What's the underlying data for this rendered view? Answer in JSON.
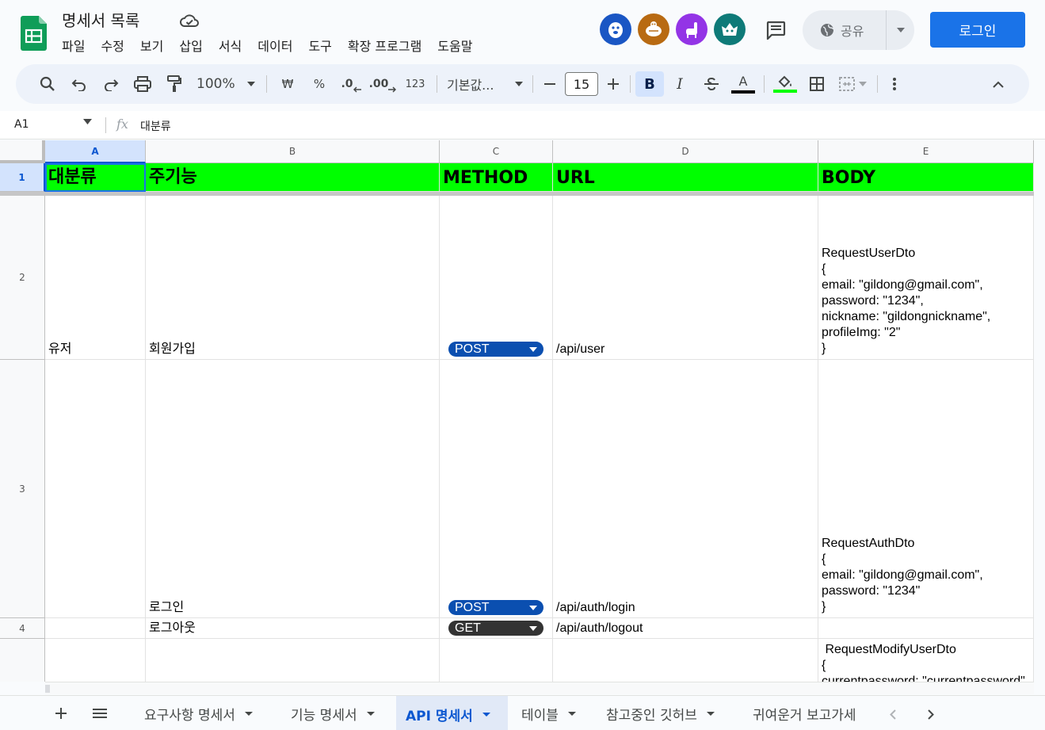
{
  "app": {
    "doc_title": "명세서 목록",
    "menus": [
      "파일",
      "수정",
      "보기",
      "삽입",
      "서식",
      "데이터",
      "도구",
      "확장 프로그램",
      "도움말"
    ],
    "share_label": "공유",
    "login_label": "로그인",
    "avatar_colors": [
      "#1a56c4",
      "#b86a12",
      "#9334e6",
      "#0e7a78"
    ]
  },
  "toolbar": {
    "zoom": "100%",
    "currency": "₩",
    "percent": "%",
    "decrease_decimal": ".0",
    "increase_decimal": ".00",
    "number_format": "123",
    "font_name": "기본값...",
    "font_size": "15",
    "text_color": "#000000",
    "fill_color": "#00ff00"
  },
  "formula_bar": {
    "cell_ref": "A1",
    "fx": "fx",
    "content": "대분류"
  },
  "columns": [
    "A",
    "B",
    "C",
    "D",
    "E"
  ],
  "rows": [
    "1",
    "2",
    "3",
    "4",
    ""
  ],
  "header_row": [
    "대분류",
    "주기능",
    "METHOD",
    "URL",
    "BODY"
  ],
  "data_rows": [
    {
      "category": "유저",
      "feature": "회원가입",
      "method": "POST",
      "url": "/api/user",
      "body": "RequestUserDto\n{\nemail: \"gildong@gmail.com\",\npassword: \"1234\",\nnickname: \"gildongnickname\",\nprofileImg: \"2\"\n}"
    },
    {
      "category": "",
      "feature": "로그인",
      "method": "POST",
      "url": "/api/auth/login",
      "body": "RequestAuthDto\n{\nemail: \"gildong@gmail.com\",\npassword: \"1234\"\n}"
    },
    {
      "category": "",
      "feature": "로그아웃",
      "method": "GET",
      "url": "/api/auth/logout",
      "body": ""
    },
    {
      "category": "",
      "feature": "",
      "method": "",
      "url": "",
      "body": " RequestModifyUserDto\n{\ncurrentpassword: \"currentpassword\""
    }
  ],
  "sheet_tabs": [
    "요구사항 명세서",
    "기능 명세서",
    "API 명세서",
    "테이블",
    "참고중인 깃허브",
    "귀여운거 보고가세"
  ],
  "active_tab": "API 명세서",
  "colors": {
    "header_fill": "#00ff00",
    "post_chip": "#0b4fb0",
    "get_chip": "#333333",
    "accent": "#1a73e8"
  }
}
